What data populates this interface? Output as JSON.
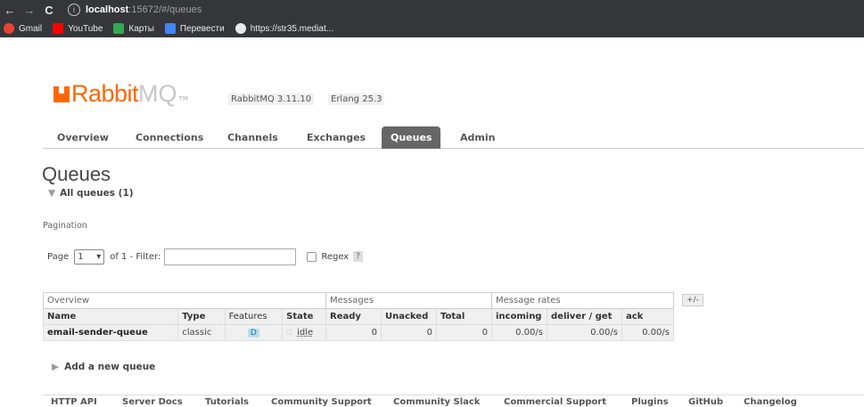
{
  "browser": {
    "url_host": "localhost",
    "url_rest": ":15672/#/queues",
    "bookmarks": [
      {
        "label": "Gmail",
        "color": "#ea4335"
      },
      {
        "label": "YouTube",
        "color": "#ff0000"
      },
      {
        "label": "Карты",
        "color": "#34a853"
      },
      {
        "label": "Перевести",
        "color": "#4285f4"
      },
      {
        "label": "https://str35.mediat...",
        "color": "#e8eaed"
      }
    ]
  },
  "header": {
    "logo_rabbit": "Rabbit",
    "logo_mq": "MQ",
    "logo_tm": "TM",
    "version": "RabbitMQ 3.11.10",
    "erlang": "Erlang 25.3"
  },
  "tabs": [
    "Overview",
    "Connections",
    "Channels",
    "Exchanges",
    "Queues",
    "Admin"
  ],
  "active_tab": "Queues",
  "page": {
    "title": "Queues",
    "section": "All queues (1)",
    "pagination_label": "Pagination",
    "page_label": "Page",
    "page_value": "1",
    "of_label": "of 1  - Filter:",
    "filter_value": "",
    "regex_label": "Regex",
    "help": "?"
  },
  "table": {
    "groups": [
      "Overview",
      "Messages",
      "Message rates"
    ],
    "headers": [
      "Name",
      "Type",
      "Features",
      "State",
      "Ready",
      "Unacked",
      "Total",
      "incoming",
      "deliver / get",
      "ack"
    ],
    "rows": [
      {
        "name": "email-sender-queue",
        "type": "classic",
        "features": "D",
        "state": "idle",
        "ready": "0",
        "unacked": "0",
        "total": "0",
        "incoming": "0.00/s",
        "deliver_get": "0.00/s",
        "ack": "0.00/s"
      }
    ],
    "plus_minus": "+/-"
  },
  "add_queue": "Add a new queue",
  "footer": [
    "HTTP API",
    "Server Docs",
    "Tutorials",
    "Community Support",
    "Community Slack",
    "Commercial Support",
    "Plugins",
    "GitHub",
    "Changelog"
  ],
  "colors": {
    "brand": "#ff6600",
    "tab_active": "#666666"
  }
}
